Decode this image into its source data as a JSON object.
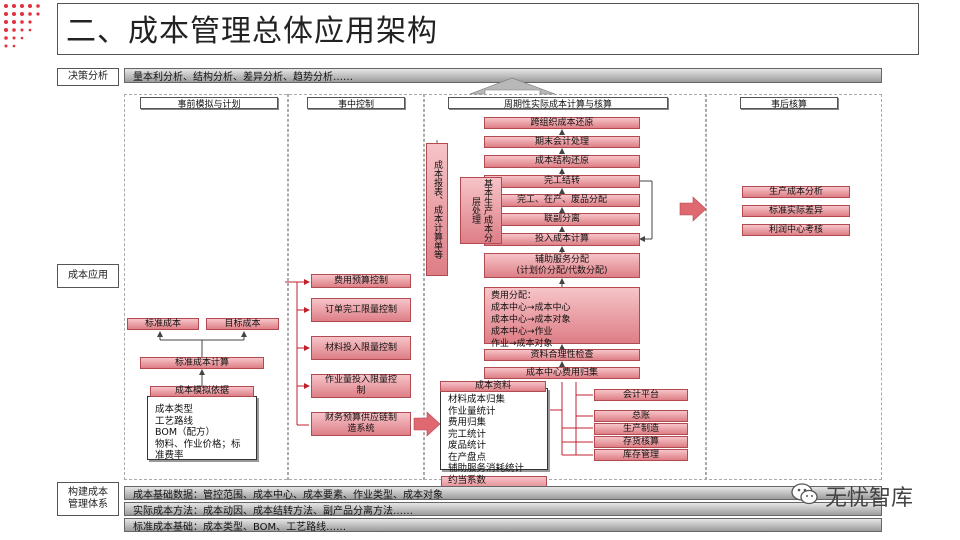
{
  "title": "二、成本管理总体应用架构",
  "side_labels": {
    "decision": "决策分析",
    "application": "成本应用",
    "system": "构建成本管理体系"
  },
  "decision_bar": "量本利分析、结构分析、差异分析、趋势分析……",
  "columns": {
    "c1": "事前模拟与计划",
    "c2": "事中控制",
    "c3": "周期性实际成本计算与核算",
    "c4": "事后核算"
  },
  "col1": {
    "standard_cost": "标准成本",
    "target_cost": "目标成本",
    "standard_calc": "标准成本计算",
    "simulation_basis": "成本模拟依据",
    "basis_items": [
      "成本类型",
      "工艺路线",
      "BOM（配方）",
      "物料、作业价格；标",
      "准费率"
    ]
  },
  "col2": {
    "items": [
      "费用预算控制",
      "订单完工限量控制",
      "材料投入限量控制",
      "作业量投入限量控制",
      "财务预算供应链制造系统"
    ]
  },
  "col3": {
    "vertical": "成本报表、成本计算单等",
    "flow": [
      "跨组织成本还原",
      "期末会计处理",
      "成本结构还原",
      "完工结转",
      "完工、在产、废品分配",
      "联副分离",
      "投入成本计算"
    ],
    "basic_alloc": "基本生产成本分层处理",
    "aux": [
      "辅助服务分配",
      "(计划价分配/代数分配)"
    ],
    "expense": [
      "费用分配：",
      "成本中心→成本中心",
      "成本中心→成本对象",
      "成本中心→作业",
      "作业→成本对象"
    ],
    "check": "资料合理性检查",
    "collect": "成本中心费用归集",
    "ledger": [
      "会计平台",
      "总账",
      "生产制造",
      "存货核算",
      "库存管理"
    ],
    "data_title": "成本资料",
    "data_items": [
      "材料成本归集",
      "作业量统计",
      "费用归集",
      "完工统计",
      "废品统计",
      "在产盘点",
      "辅助服务消耗统计",
      "约当系数"
    ]
  },
  "col4": {
    "items": [
      "生产成本分析",
      "标准实际差异",
      "利润中心考核"
    ]
  },
  "bottom_bars": [
    "成本基础数据：管控范围、成本中心、成本要素、作业类型、成本对象",
    "实际成本方法：成本动因、成本结转方法、副产品分离方法……",
    "标准成本基础：成本类型、BOM、工艺路线……"
  ],
  "logo": "无忧智库",
  "colors": {
    "accent": "#e0303c",
    "pink": "#de7e86",
    "gray": "#9c9c9c"
  }
}
